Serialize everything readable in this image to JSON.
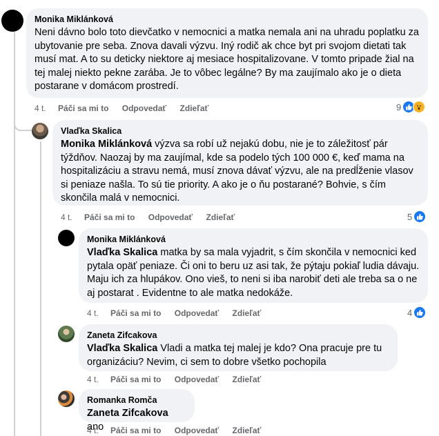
{
  "comments": [
    {
      "author": "Monika Miklánková",
      "mention": "",
      "text": "Neni dávno bolo toto dievčatko v nemocnici a matka nemala ani na uhradu poplatku za ubytovanie pre seba. Znova davali výzvu. Iný rodič ak chce byt pri svojom dietati tak musí mat. A to su deticky niektore aj mesiace hospitalizovane. V tomto pripade žial na tej malej niekto pekne zarába. Je to vôbec legálne? By ma zaujímalo ako je o dieta postarane v domácom prostredí.",
      "time": "4 t.",
      "like": "Páči sa mi to",
      "reply": "Odpovedať",
      "share": "Zdieľať",
      "reaction_count": "9",
      "reactions": [
        "like-icon",
        "wow-icon"
      ]
    },
    {
      "author": "Vlaďka Skalica",
      "mention": "Monika Miklánková",
      "text": " výzva sa robí už nejakú dobu, nie je to záležitosť pár týždňov. Naozaj by ma zaujímal, kde sa podelo tých 100 000 €, keď mama na hospitalizáciu a stravu nemá, musí znova dávať výzvu, ale na predĺženie vlasov si peniaze našla. To sú tie priority. A ako je o ňu postarané? Bohvie, s čím skončila malá v nemocnici.",
      "time": "4 t.",
      "like": "Páči sa mi to",
      "reply": "Odpovedať",
      "share": "Zdieľať",
      "reaction_count": "5",
      "reactions": [
        "like-icon"
      ]
    },
    {
      "author": "Monika Miklánková",
      "mention": "Vlaďka Skalica",
      "text": " matka by sa mala vyjadrit, s čím skončila v nemocnici ked pytala opäť peniaze. Či oni to beru uz asi tak, že pýtaju pokiaľ ludia dávaju. Maju ich za hlupákov. Ono vieš, to neni si iba narobiť deti ale treba sa o ne aj postarat . Evidentne to ale matka nedokáže.",
      "time": "4 t.",
      "like": "Páči sa mi to",
      "reply": "Odpovedať",
      "share": "Zdieľať",
      "reaction_count": "4",
      "reactions": [
        "like-icon"
      ]
    },
    {
      "author": "Zaneta Zifcakova",
      "mention": "Vlaďka Skalica",
      "text": " Vladi a matka tej malej je kdo? Ona pracuje pre tu organizáciu? Nevim, ci sem to dobre všetko pochopila",
      "time": "4 t.",
      "like": "Páči sa mi to",
      "reply": "Odpovedať",
      "share": "Zdieľať"
    },
    {
      "author": "Romanka Romča",
      "mention": "Zaneta Zifcakova",
      "text": " ano",
      "time": "4 t.",
      "like": "Páči sa mi to",
      "reply": "Odpovedať",
      "share": "Zdieľať"
    }
  ],
  "colors": {
    "bubble": "#f0f2f5",
    "meta": "#65676b",
    "like": "#1877f2",
    "wow": "#f7b125",
    "thread": "#ced0d4"
  }
}
